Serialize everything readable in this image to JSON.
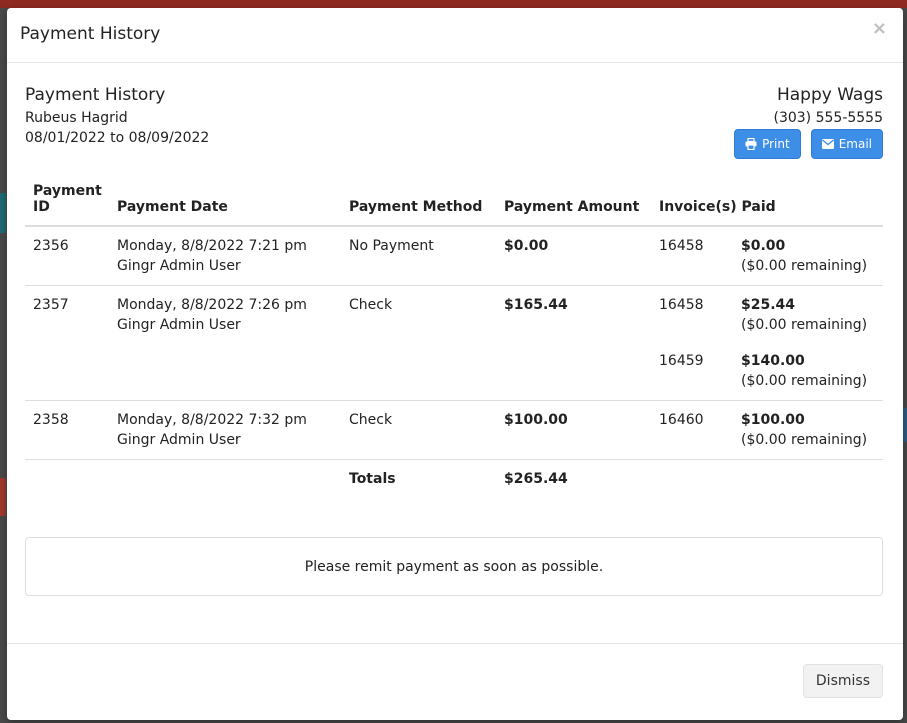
{
  "modal": {
    "title": "Payment History",
    "close_glyph": "×"
  },
  "report": {
    "title": "Payment History",
    "client": "Rubeus Hagrid",
    "date_range": "08/01/2022 to 08/09/2022"
  },
  "business": {
    "name": "Happy Wags",
    "phone": "(303) 555-5555"
  },
  "buttons": {
    "print": "Print",
    "email": "Email",
    "dismiss": "Dismiss"
  },
  "table": {
    "headers": [
      "Payment ID",
      "Payment Date",
      "Payment Method",
      "Payment Amount",
      "Invoice(s) Paid"
    ],
    "rows": [
      {
        "id": "2356",
        "date": "Monday, 8/8/2022 7:21 pm Gingr Admin User",
        "method": "No Payment",
        "amount": "$0.00",
        "invoices": [
          {
            "number": "16458",
            "amount": "$0.00",
            "remaining": "($0.00 remaining)"
          }
        ]
      },
      {
        "id": "2357",
        "date": "Monday, 8/8/2022 7:26 pm Gingr Admin User",
        "method": "Check",
        "amount": "$165.44",
        "invoices": [
          {
            "number": "16458",
            "amount": "$25.44",
            "remaining": "($0.00 remaining)"
          },
          {
            "number": "16459",
            "amount": "$140.00",
            "remaining": "($0.00 remaining)"
          }
        ]
      },
      {
        "id": "2358",
        "date": "Monday, 8/8/2022 7:32 pm Gingr Admin User",
        "method": "Check",
        "amount": "$100.00",
        "invoices": [
          {
            "number": "16460",
            "amount": "$100.00",
            "remaining": "($0.00 remaining)"
          }
        ]
      }
    ],
    "totals_label": "Totals",
    "totals_amount": "$265.44"
  },
  "notice": "Please remit payment as soon as possible.",
  "colors": {
    "primary_button": "#3d8ee6",
    "dismiss_button": "#f2f2f2"
  },
  "icons": {
    "print": "printer-icon",
    "email": "envelope-icon"
  }
}
